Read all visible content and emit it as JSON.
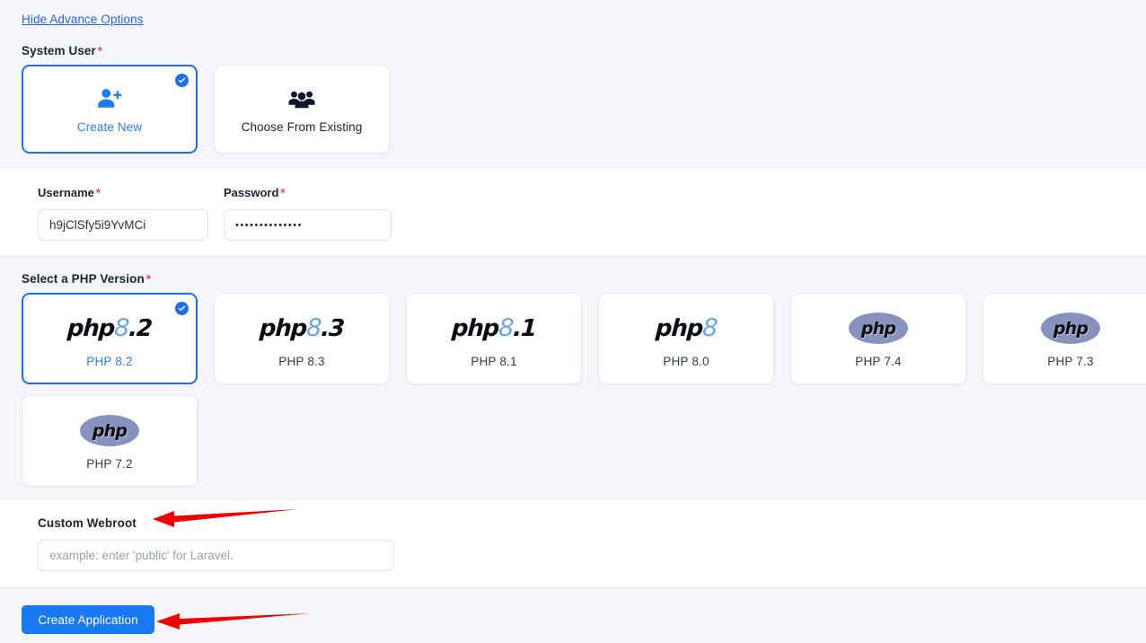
{
  "top": {
    "toggle_link": "Hide Advance Options"
  },
  "system_user": {
    "label": "System User",
    "required_mark": "*",
    "options": [
      {
        "label": "Create New",
        "icon": "person-add-icon",
        "selected": true
      },
      {
        "label": "Choose From Existing",
        "icon": "people-group-icon",
        "selected": false
      }
    ]
  },
  "credentials": {
    "username": {
      "label": "Username",
      "required_mark": "*",
      "value": "h9jClSfy5i9YvMCi",
      "placeholder": ""
    },
    "password": {
      "label": "Password",
      "required_mark": "*",
      "value": "••••••••••••••",
      "placeholder": ""
    }
  },
  "php": {
    "label": "Select a PHP Version",
    "required_mark": "*",
    "versions": [
      {
        "caption": "PHP 8.2",
        "logo_style": "php8",
        "logo_suffix": ".2",
        "selected": true
      },
      {
        "caption": "PHP 8.3",
        "logo_style": "php8",
        "logo_suffix": ".3",
        "selected": false
      },
      {
        "caption": "PHP 8.1",
        "logo_style": "php8",
        "logo_suffix": ".1",
        "selected": false
      },
      {
        "caption": "PHP 8.0",
        "logo_style": "php8",
        "logo_suffix": "",
        "selected": false
      },
      {
        "caption": "PHP 7.4",
        "logo_style": "php-oval",
        "logo_suffix": "",
        "selected": false
      },
      {
        "caption": "PHP 7.3",
        "logo_style": "php-oval",
        "logo_suffix": "",
        "selected": false
      },
      {
        "caption": "PHP 7.2",
        "logo_style": "php-oval",
        "logo_suffix": "",
        "selected": false
      }
    ],
    "logo_text": "php"
  },
  "webroot": {
    "label": "Custom Webroot",
    "value": "",
    "placeholder": "example: enter 'public' for Laravel."
  },
  "actions": {
    "create_label": "Create Application"
  },
  "annotations": {
    "arrow_color": "#ee0000",
    "arrow_webroot": "points-to-custom-webroot-label",
    "arrow_button": "points-to-create-application-button"
  },
  "colors": {
    "accent": "#1f6feb",
    "button": "#1878f2",
    "page_bg": "#f4f5f9",
    "panel_bg": "#ffffff",
    "required": "#ef4444",
    "php_oval": "#8892bf"
  }
}
